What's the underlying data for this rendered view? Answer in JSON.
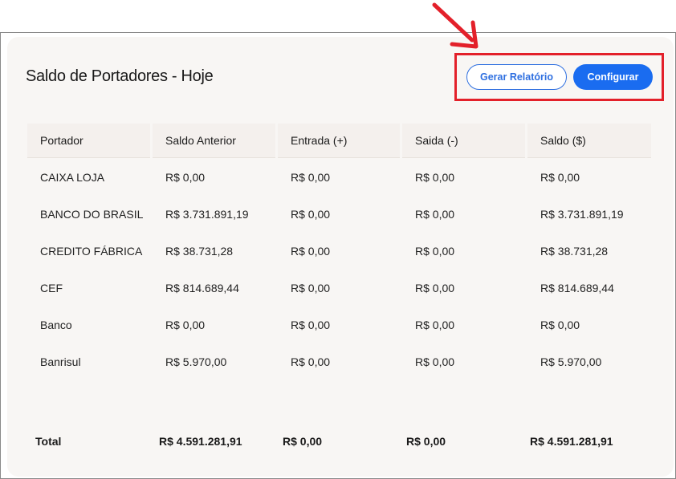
{
  "page": {
    "title": "Saldo de Portadores - Hoje"
  },
  "actions": {
    "report_label": "Gerar Relatório",
    "configure_label": "Configurar"
  },
  "colors": {
    "primary": "#1a6cf0",
    "highlight": "#e3202a",
    "card_background": "#f8f6f4"
  },
  "table": {
    "columns": [
      "Portador",
      "Saldo Anterior",
      "Entrada (+)",
      "Saida (-)",
      "Saldo ($)"
    ],
    "rows": [
      [
        "CAIXA LOJA",
        "R$ 0,00",
        "R$ 0,00",
        "R$ 0,00",
        "R$ 0,00"
      ],
      [
        "BANCO DO BRASIL",
        "R$ 3.731.891,19",
        "R$ 0,00",
        "R$ 0,00",
        "R$ 3.731.891,19"
      ],
      [
        "CREDITO FÁBRICA",
        "R$ 38.731,28",
        "R$ 0,00",
        "R$ 0,00",
        "R$ 38.731,28"
      ],
      [
        "CEF",
        "R$ 814.689,44",
        "R$ 0,00",
        "R$ 0,00",
        "R$ 814.689,44"
      ],
      [
        "Banco",
        "R$ 0,00",
        "R$ 0,00",
        "R$ 0,00",
        "R$ 0,00"
      ],
      [
        "Banrisul",
        "R$ 5.970,00",
        "R$ 0,00",
        "R$ 0,00",
        "R$ 5.970,00"
      ]
    ],
    "totals": [
      "Total",
      "R$ 4.591.281,91",
      "R$ 0,00",
      "R$ 0,00",
      "R$ 4.591.281,91"
    ]
  }
}
